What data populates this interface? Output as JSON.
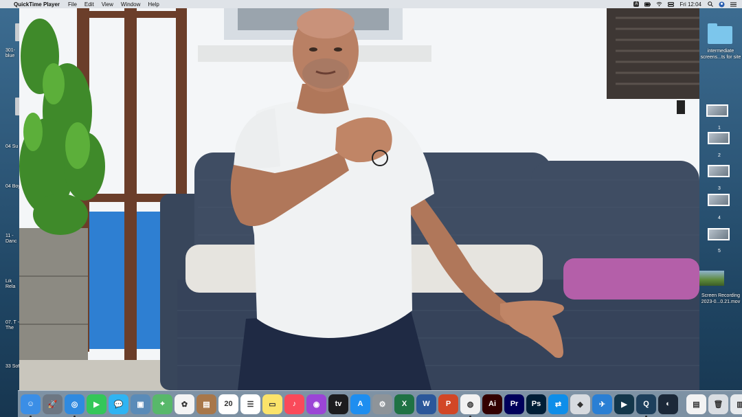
{
  "menubar": {
    "app_name": "QuickTime Player",
    "menus": [
      "File",
      "Edit",
      "View",
      "Window",
      "Help"
    ],
    "input_badge": "A",
    "clock": "Fri 12:04"
  },
  "desktop_left": {
    "labels": [
      "301-\nblue",
      "04\nSu",
      "04\nBoy",
      "11 -\nDanc",
      "Lik\nRela",
      "07. T\n- The",
      "33\nSof"
    ]
  },
  "desktop_right": {
    "folder_label": "intermediate\nscreens...ts for site",
    "screenshot_numbers": [
      "1",
      "2",
      "3",
      "4",
      "5"
    ],
    "video_label": "Screen Recording\n2023-0...0.21.mov"
  },
  "dock": {
    "apps": [
      {
        "name": "Finder",
        "color": "#3b8ee6",
        "glyph": "☺",
        "running": true
      },
      {
        "name": "Launchpad",
        "color": "#6d7783",
        "glyph": "🚀",
        "running": false
      },
      {
        "name": "Safari",
        "color": "#2f8ae0",
        "glyph": "◎",
        "running": true
      },
      {
        "name": "FaceTime",
        "color": "#34c759",
        "glyph": "▶",
        "running": false
      },
      {
        "name": "Messages",
        "color": "#2fb4f3",
        "glyph": "💬",
        "running": false
      },
      {
        "name": "Preview",
        "color": "#5a8bb8",
        "glyph": "▣",
        "running": false
      },
      {
        "name": "Maps",
        "color": "#58b86a",
        "glyph": "⌖",
        "running": false
      },
      {
        "name": "Photos",
        "color": "#f4f4f4",
        "glyph": "✿",
        "running": false
      },
      {
        "name": "Notebook",
        "color": "#a8774a",
        "glyph": "▤",
        "running": false
      },
      {
        "name": "Calendar",
        "color": "#ffffff",
        "glyph": "20",
        "running": false
      },
      {
        "name": "Reminders",
        "color": "#ffffff",
        "glyph": "☰",
        "running": false
      },
      {
        "name": "Notes",
        "color": "#fbe36a",
        "glyph": "▭",
        "running": false
      },
      {
        "name": "Music",
        "color": "#fa4a5a",
        "glyph": "♪",
        "running": false
      },
      {
        "name": "Podcasts",
        "color": "#9b45d6",
        "glyph": "◉",
        "running": false
      },
      {
        "name": "TV",
        "color": "#1c1c1e",
        "glyph": "tv",
        "running": false
      },
      {
        "name": "App Store",
        "color": "#1e8ef0",
        "glyph": "A",
        "running": false
      },
      {
        "name": "System Preferences",
        "color": "#8e9499",
        "glyph": "⚙",
        "running": false
      },
      {
        "name": "Excel",
        "color": "#1f7244",
        "glyph": "X",
        "running": false
      },
      {
        "name": "Word",
        "color": "#2b579a",
        "glyph": "W",
        "running": false
      },
      {
        "name": "PowerPoint",
        "color": "#d24726",
        "glyph": "P",
        "running": false
      },
      {
        "name": "Chrome",
        "color": "#f2f2f2",
        "glyph": "◍",
        "running": true
      },
      {
        "name": "Illustrator",
        "color": "#330000",
        "glyph": "Ai",
        "running": false
      },
      {
        "name": "Premiere Pro",
        "color": "#00005b",
        "glyph": "Pr",
        "running": false
      },
      {
        "name": "Photoshop",
        "color": "#001e36",
        "glyph": "Ps",
        "running": false
      },
      {
        "name": "TeamViewer",
        "color": "#0e8ee9",
        "glyph": "⇄",
        "running": false
      },
      {
        "name": "Roblox",
        "color": "#d7dbe0",
        "glyph": "◆",
        "running": false
      },
      {
        "name": "Airplane App",
        "color": "#2a7fd4",
        "glyph": "✈",
        "running": false
      },
      {
        "name": "Filmora",
        "color": "#13364a",
        "glyph": "▶",
        "running": false
      },
      {
        "name": "QuickTime Player",
        "color": "#1d3f5c",
        "glyph": "Q",
        "running": true
      },
      {
        "name": "Steam",
        "color": "#1b2838",
        "glyph": "◐",
        "running": false
      }
    ],
    "right_items": [
      {
        "name": "Document",
        "color": "#f3f3f3",
        "glyph": "▤"
      },
      {
        "name": "Trash",
        "color": "#d9dde2",
        "glyph": "🗑"
      },
      {
        "name": "Downloads Stack",
        "color": "#e6e9ec",
        "glyph": "▥"
      }
    ]
  },
  "colors": {
    "menubar_bg": "#dfe3e8",
    "shirt": "#f0f2f3",
    "sofa": "#3f4d63",
    "cushion_purple": "#b45fa9",
    "wall_blue": "#2e7fd2"
  }
}
